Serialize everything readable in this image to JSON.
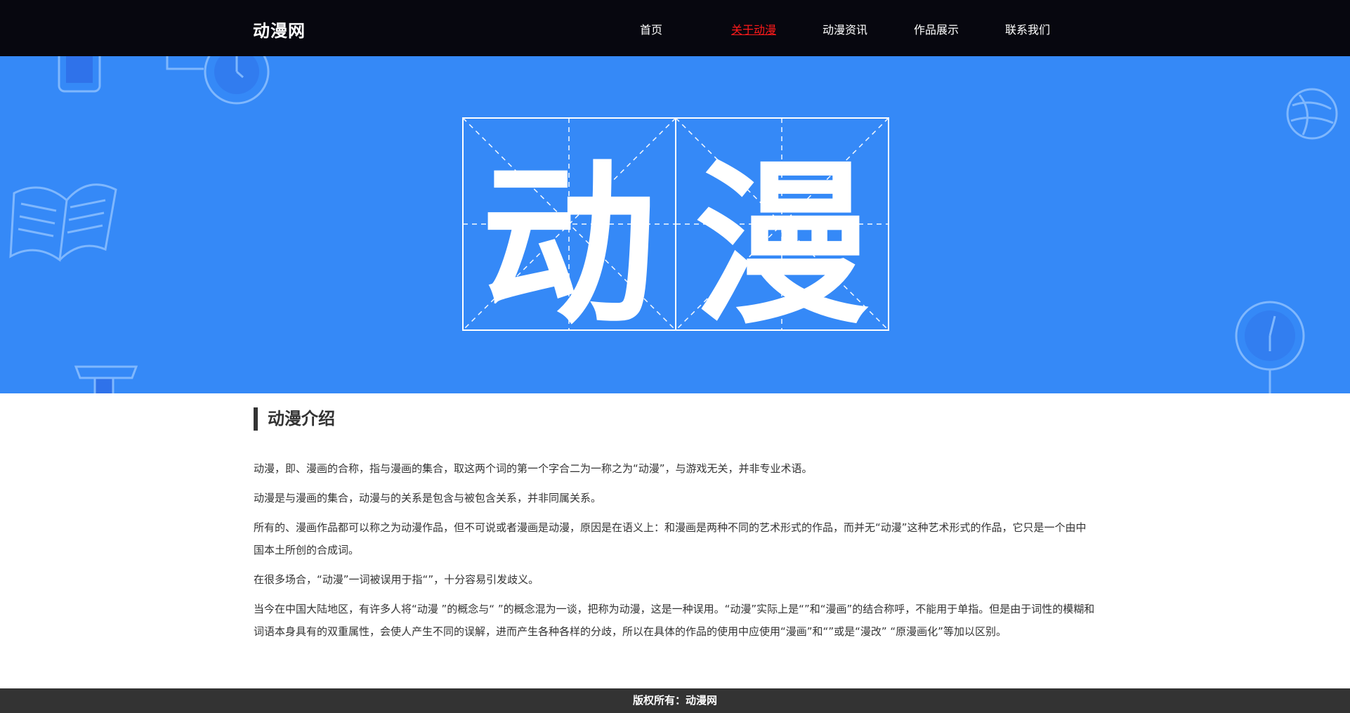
{
  "header": {
    "logo": "动漫网",
    "nav": [
      {
        "label": "首页",
        "active": false
      },
      {
        "label": "关于动漫",
        "active": true
      },
      {
        "label": "动漫资讯",
        "active": false
      },
      {
        "label": "作品展示",
        "active": false
      },
      {
        "label": "联系我们",
        "active": false
      }
    ]
  },
  "banner": {
    "chars": [
      "动",
      "漫"
    ],
    "background": "#3589f7"
  },
  "content": {
    "heading": "动漫介绍",
    "paragraphs": [
      "动漫，即、漫画的合称，指与漫画的集合，取这两个词的第一个字合二为一称之为“动漫”，与游戏无关，并非专业术语。",
      "动漫是与漫画的集合，动漫与的关系是包含与被包含关系，并非同属关系。",
      "所有的、漫画作品都可以称之为动漫作品，但不可说或者漫画是动漫，原因是在语义上：和漫画是两种不同的艺术形式的作品，而并无“动漫”这种艺术形式的作品，它只是一个由中国本土所创的合成词。",
      "在很多场合，“动漫”一词被误用于指“”，十分容易引发歧义。",
      "当今在中国大陆地区，有许多人将“动漫 ”的概念与“ ”的概念混为一谈，把称为动漫，这是一种误用。“动漫”实际上是“”和“漫画”的结合称呼，不能用于单指。但是由于词性的模糊和词语本身具有的双重属性，会使人产生不同的误解，进而产生各种各样的分歧，所以在具体的作品的使用中应使用“漫画”和“”或是“漫改” “原漫画化”等加以区别。"
    ]
  },
  "footer": {
    "text": "版权所有：动漫网"
  },
  "colors": {
    "topbar": "#07070f",
    "accent_active": "#ff1a1a",
    "footer": "#333333"
  }
}
